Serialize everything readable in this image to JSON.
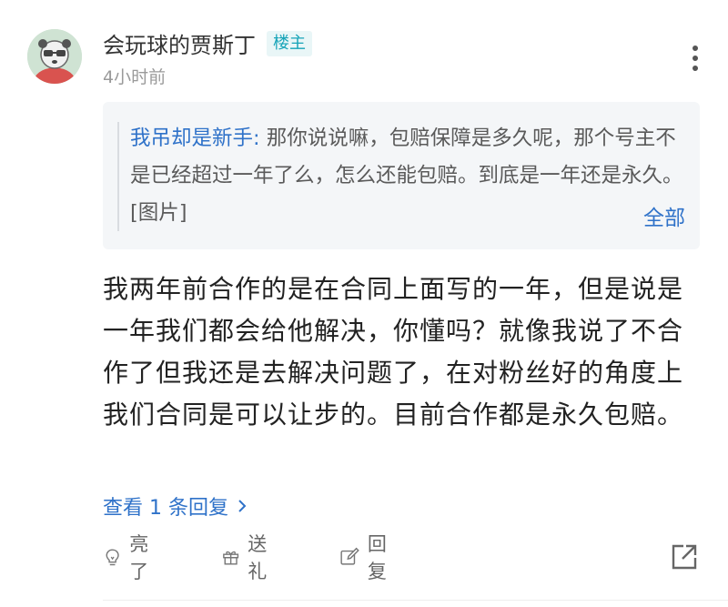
{
  "comment": {
    "author": "会玩球的贾斯丁",
    "badge": "楼主",
    "time": "4小时前",
    "quote": {
      "user": "我吊却是新手:",
      "text": "那你说说嘛，包赔保障是多久呢，那个号主不是已经超过一年了么，怎么还能包赔。到底是一年还是永久。[图片]",
      "expand_label": "全部"
    },
    "body": "我两年前合作的是在合同上面写的一年，但是说是一年我们都会给他解决，你懂吗？就像我说了不合作了但我还是去解决问题了，在对粉丝好的角度上我们合同是可以让步的。目前合作都是永久包赔。",
    "view_replies": "查看 1 条回复"
  },
  "actions": {
    "like_label": "亮了",
    "gift_label": "送礼",
    "reply_label": "回复"
  },
  "icons": {
    "more": "more-vertical-icon",
    "like": "lightbulb-icon",
    "gift": "gift-icon",
    "reply": "edit-icon",
    "share": "share-icon",
    "chevron": "chevron-right-icon"
  },
  "colors": {
    "link": "#2f72c9",
    "badge": "#17a4b8",
    "meta": "#9a9a9a",
    "quote_bg": "#f4f6f8"
  }
}
